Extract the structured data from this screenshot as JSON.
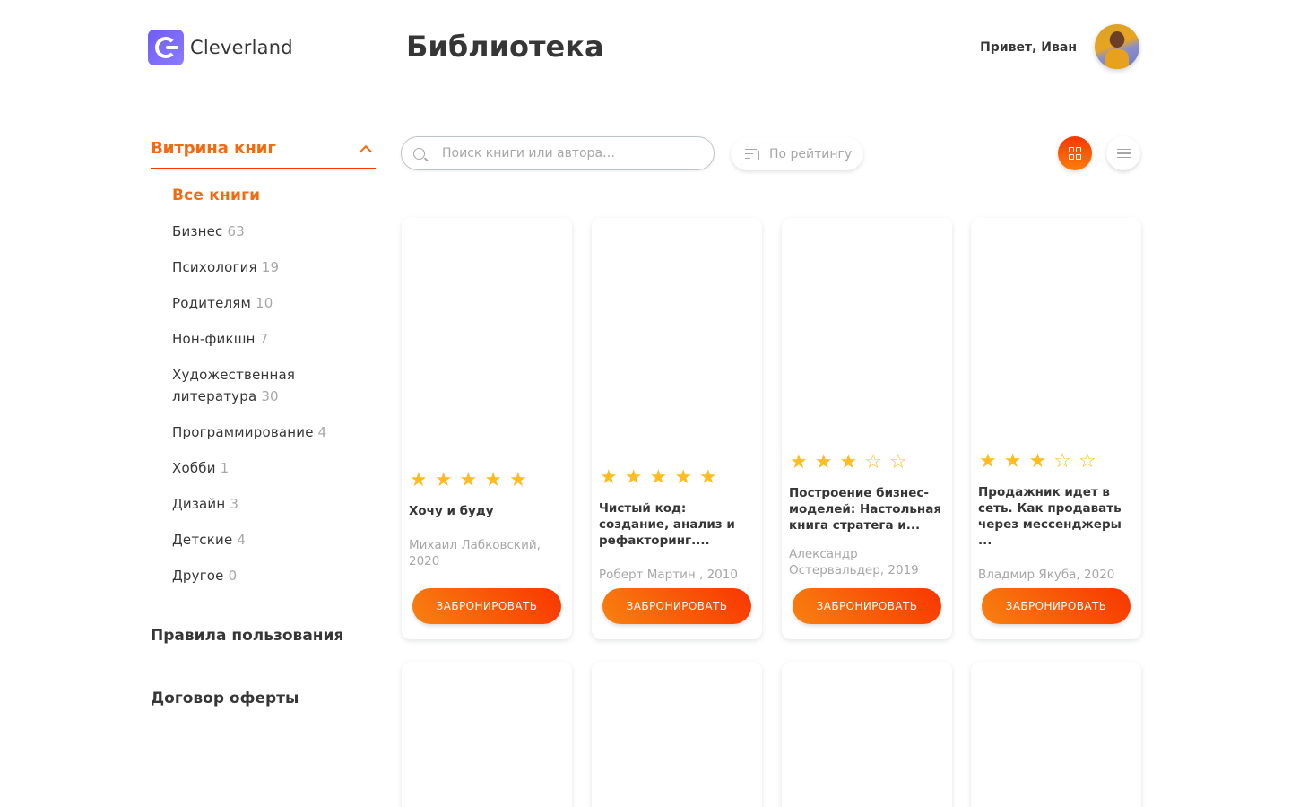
{
  "header": {
    "logo_text": "Cleverland",
    "page_title": "Библиотека",
    "greeting": "Привет, Иван"
  },
  "sidebar": {
    "showcase_title": "Витрина книг",
    "categories": [
      {
        "label": "Все книги",
        "count": ""
      },
      {
        "label": "Бизнес",
        "count": "63"
      },
      {
        "label": "Психология",
        "count": "19"
      },
      {
        "label": "Родителям",
        "count": "10"
      },
      {
        "label": "Нон-фикшн",
        "count": "7"
      },
      {
        "label": "Художественная литература",
        "count": "30"
      },
      {
        "label": "Программирование",
        "count": "4"
      },
      {
        "label": "Хобби",
        "count": "1"
      },
      {
        "label": "Дизайн",
        "count": "3"
      },
      {
        "label": "Детские",
        "count": "4"
      },
      {
        "label": "Другое",
        "count": "0"
      }
    ],
    "rules_link": "Правила пользования",
    "offer_link": "Договор оферты"
  },
  "toolbar": {
    "search_placeholder": "Поиск книги или автора…",
    "sort_label": "По рейтингу"
  },
  "books": [
    {
      "rating": 5,
      "title": "Хочу и буду",
      "author": "Михаил Лабковский, 2020",
      "button": "ЗАБРОНИРОВАТЬ"
    },
    {
      "rating": 5,
      "title": "Чистый код: создание, анализ и рефакторинг....",
      "author": "Роберт Мартин , 2010",
      "button": "ЗАБРОНИРОВАТЬ"
    },
    {
      "rating": 3,
      "title": "Построение бизнес-моделей: Настольная книга стратега и...",
      "author": "Александр Остервальдер, 2019",
      "button": "ЗАБРОНИРОВАТЬ"
    },
    {
      "rating": 3,
      "title": "Продажник идет в сеть. Как продавать через мессенджеры ...",
      "author": "Владмир Якуба, 2020",
      "button": "ЗАБРОНИРОВАТЬ"
    }
  ],
  "colors": {
    "accent": "#f46a12",
    "accent_start": "#f83600",
    "star": "#ffbc1f",
    "text": "#363636",
    "muted": "#a7a7a7"
  }
}
